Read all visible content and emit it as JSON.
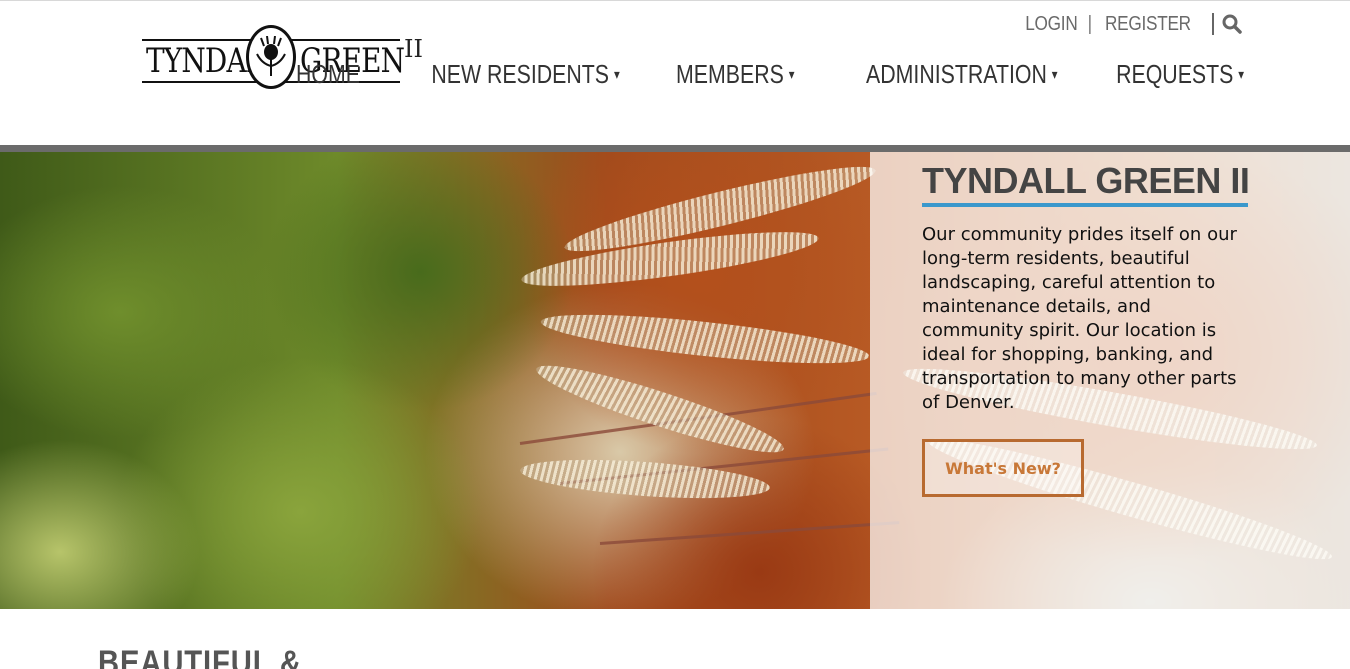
{
  "brand": {
    "logo_left": "TYNDALL",
    "logo_right": "GREEN",
    "logo_roman": "II"
  },
  "utility_nav": {
    "login": "LOGIN",
    "separator": "|",
    "register": "REGISTER",
    "search_icon": "search-icon"
  },
  "main_nav": {
    "items": [
      {
        "label": "HOME",
        "has_dropdown": false
      },
      {
        "label": "NEW RESIDENTS",
        "has_dropdown": true
      },
      {
        "label": "MEMBERS",
        "has_dropdown": true
      },
      {
        "label": "ADMINISTRATION",
        "has_dropdown": true
      },
      {
        "label": "REQUESTS",
        "has_dropdown": true
      }
    ],
    "caret": "▾"
  },
  "hero": {
    "title": "TYNDALL GREEN II",
    "body": "Our community prides itself on our long-term residents, beautiful landscaping, careful attention to maintenance details, and community spirit. Our location is ideal for shopping, banking, and transportation to many other parts of Denver.",
    "button_label": "What's New?"
  },
  "section": {
    "heading": "BEAUTIFUL &"
  },
  "colors": {
    "accent_blue": "#3a98cc",
    "button_orange": "#c87838",
    "header_bar": "#6b6b6b"
  }
}
